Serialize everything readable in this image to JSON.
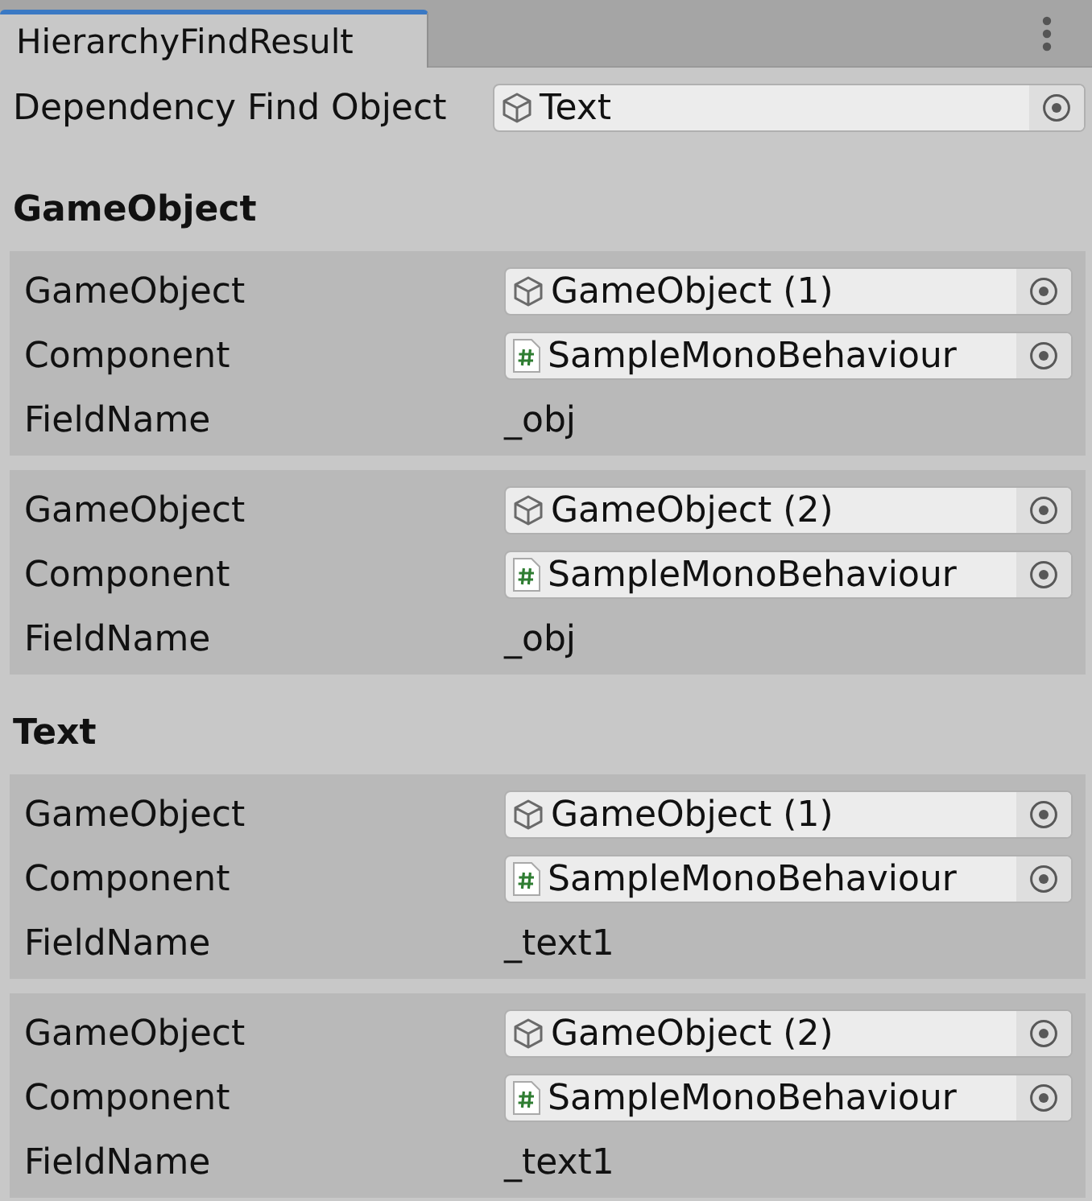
{
  "tabs": [
    {
      "label": "HierarchyFindResult",
      "selected": true
    }
  ],
  "find_object": {
    "label": "Dependency Find Object",
    "kind": "gameobject",
    "value": "Text"
  },
  "groups": [
    {
      "title": "GameObject",
      "results": [
        {
          "fields": [
            {
              "label": "GameObject",
              "kind": "gameobject",
              "value": "GameObject (1)"
            },
            {
              "label": "Component",
              "kind": "script",
              "value": "SampleMonoBehaviour"
            },
            {
              "label": "FieldName",
              "kind": "text",
              "value": "_obj"
            }
          ]
        },
        {
          "fields": [
            {
              "label": "GameObject",
              "kind": "gameobject",
              "value": "GameObject (2)"
            },
            {
              "label": "Component",
              "kind": "script",
              "value": "SampleMonoBehaviour"
            },
            {
              "label": "FieldName",
              "kind": "text",
              "value": "_obj"
            }
          ]
        }
      ]
    },
    {
      "title": "Text",
      "results": [
        {
          "fields": [
            {
              "label": "GameObject",
              "kind": "gameobject",
              "value": "GameObject (1)"
            },
            {
              "label": "Component",
              "kind": "script",
              "value": "SampleMonoBehaviour"
            },
            {
              "label": "FieldName",
              "kind": "text",
              "value": "_text1"
            }
          ]
        },
        {
          "fields": [
            {
              "label": "GameObject",
              "kind": "gameobject",
              "value": "GameObject (2)"
            },
            {
              "label": "Component",
              "kind": "script",
              "value": "SampleMonoBehaviour"
            },
            {
              "label": "FieldName",
              "kind": "text",
              "value": "_text1"
            }
          ]
        }
      ]
    }
  ]
}
